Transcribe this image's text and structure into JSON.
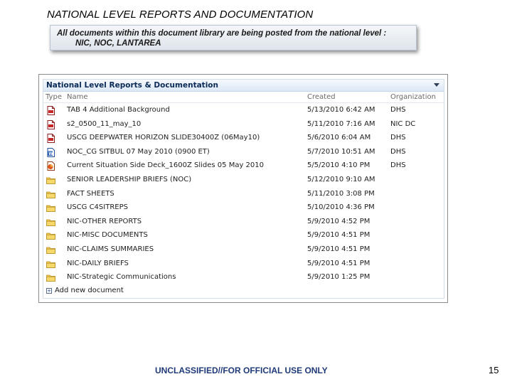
{
  "slide": {
    "title": "NATIONAL LEVEL REPORTS AND DOCUMENTATION",
    "note_line1": "All documents within this document library are being posted from the national level :",
    "note_line2": "NIC, NOC, LANTAREA",
    "footer": "UNCLASSIFIED//FOR OFFICIAL USE ONLY",
    "page_number": "15"
  },
  "library": {
    "title": "National Level Reports & Documentation",
    "columns": {
      "type": "Type",
      "name": "Name",
      "created": "Created",
      "organization": "Organization"
    },
    "rows": [
      {
        "icon": "pdf-icon",
        "name": "TAB 4 Additional Background",
        "created": "5/13/2010 6:42 AM",
        "org": "DHS"
      },
      {
        "icon": "pdf-icon",
        "name": "s2_0500_11_may_10",
        "created": "5/11/2010 7:16 AM",
        "org": "NIC DC"
      },
      {
        "icon": "pdf-icon",
        "name": "USCG DEEPWATER HORIZON SLIDE30400Z (06May10)",
        "created": "5/6/2010 6:04 AM",
        "org": "DHS"
      },
      {
        "icon": "word-icon",
        "name": "NOC_CG SITBUL 07 May 2010 (0900 ET)",
        "created": "5/7/2010 10:51 AM",
        "org": "DHS"
      },
      {
        "icon": "ppt-icon",
        "name": "Current Situation Side Deck_1600Z Slides 05 May 2010",
        "created": "5/5/2010 4:10 PM",
        "org": "DHS"
      },
      {
        "icon": "folder-icon",
        "name": "SENIOR LEADERSHIP BRIEFS (NOC)",
        "created": "5/12/2010 9:10 AM",
        "org": ""
      },
      {
        "icon": "folder-icon",
        "name": "FACT SHEETS",
        "created": "5/11/2010 3:08 PM",
        "org": ""
      },
      {
        "icon": "folder-icon",
        "name": "USCG C4SITREPS",
        "created": "5/10/2010 4:36 PM",
        "org": ""
      },
      {
        "icon": "folder-icon",
        "name": "NIC-OTHER REPORTS",
        "created": "5/9/2010 4:52 PM",
        "org": ""
      },
      {
        "icon": "folder-icon",
        "name": "NIC-MISC DOCUMENTS",
        "created": "5/9/2010 4:51 PM",
        "org": ""
      },
      {
        "icon": "folder-icon",
        "name": "NIC-CLAIMS SUMMARIES",
        "created": "5/9/2010 4:51 PM",
        "org": ""
      },
      {
        "icon": "folder-icon",
        "name": "NIC-DAILY BRIEFS",
        "created": "5/9/2010 4:51 PM",
        "org": ""
      },
      {
        "icon": "folder-icon",
        "name": "NIC-Strategic Communications",
        "created": "5/9/2010 1:25 PM",
        "org": ""
      }
    ],
    "add_label": "Add new document"
  }
}
